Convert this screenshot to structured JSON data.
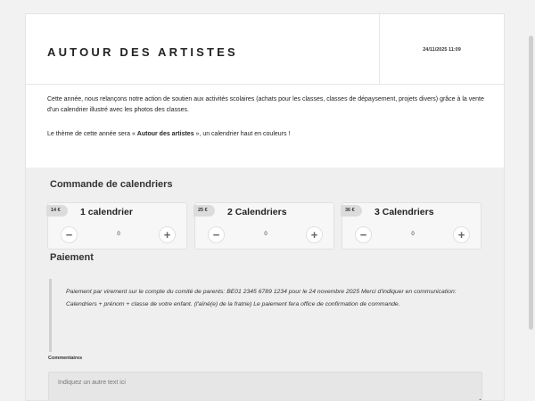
{
  "header": {
    "title": "AUTOUR DES ARTISTES",
    "date": "24/11/2025 11:09"
  },
  "intro": {
    "paragraph1": "Cette année, nous relançons notre action de soutien aux activités scolaires (achats pour les classes, classes de dépaysement, projets divers) grâce à la vente d'un calendrier illustré avec les photos des classes.",
    "paragraph2_before": "Le thème de cette année sera « ",
    "paragraph2_bold": "Autour des artistes",
    "paragraph2_after": " », un calendrier haut en couleurs !"
  },
  "order": {
    "title": "Commande de calendriers",
    "items": [
      {
        "price": "14 €",
        "label": "1 calendrier",
        "quantity": "0"
      },
      {
        "price": "25 €",
        "label": "2 Calendriers",
        "quantity": "0"
      },
      {
        "price": "36 €",
        "label": "3 Calendriers",
        "quantity": "0"
      }
    ],
    "minus_symbol": "−",
    "plus_symbol": "+"
  },
  "payment": {
    "title": "Paiement",
    "text": "Paiement par virement sur le compte du comité de parents: BE01 2345 6789 1234 pour le 24 novembre 2025 Merci d'indiquer en communication: Calendriers + prénom + classe de votre enfant. (l'aîné(e) de la fratrie) Le paiement fera office de confirmation de commande."
  },
  "comments": {
    "label": "Commentaires",
    "placeholder": "Indiquez un autre text ici",
    "value": ""
  }
}
